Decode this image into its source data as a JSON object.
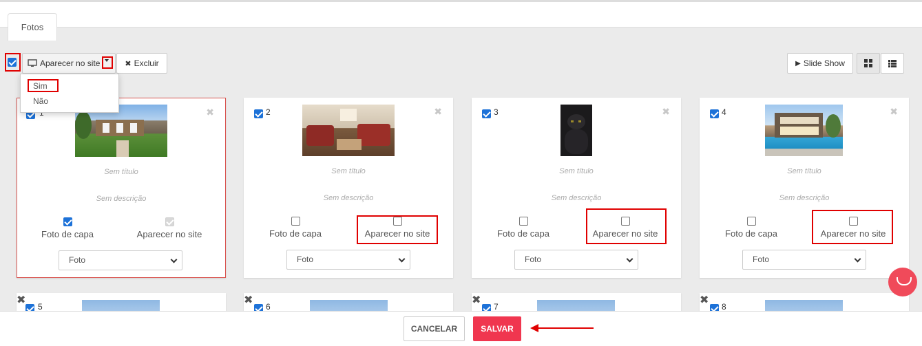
{
  "tab": {
    "label": "Fotos"
  },
  "toolbar": {
    "aparecer_label": "Aparecer no site",
    "excluir_label": "Excluir",
    "slideshow_label": "Slide Show"
  },
  "dropdown": {
    "items": [
      "Sim",
      "Não"
    ]
  },
  "cards": [
    {
      "num": "1",
      "title": "Sem título",
      "desc": "Sem descrição",
      "capa_label": "Foto de capa",
      "site_label": "Aparecer no site",
      "select_value": "Foto"
    },
    {
      "num": "2",
      "title": "Sem título",
      "desc": "Sem descrição",
      "capa_label": "Foto de capa",
      "site_label": "Aparecer no site",
      "select_value": "Foto"
    },
    {
      "num": "3",
      "title": "Sem título",
      "desc": "Sem descrição",
      "capa_label": "Foto de capa",
      "site_label": "Aparecer no site",
      "select_value": "Foto"
    },
    {
      "num": "4",
      "title": "Sem título",
      "desc": "Sem descrição",
      "capa_label": "Foto de capa",
      "site_label": "Aparecer no site",
      "select_value": "Foto"
    }
  ],
  "cards_row2": [
    {
      "num": "5"
    },
    {
      "num": "6"
    },
    {
      "num": "7"
    },
    {
      "num": "8"
    }
  ],
  "footer": {
    "cancel_label": "CANCELAR",
    "save_label": "SALVAR"
  },
  "colors": {
    "accent": "#1d72d8",
    "save": "#f0364f",
    "highlight": "#e00000"
  }
}
